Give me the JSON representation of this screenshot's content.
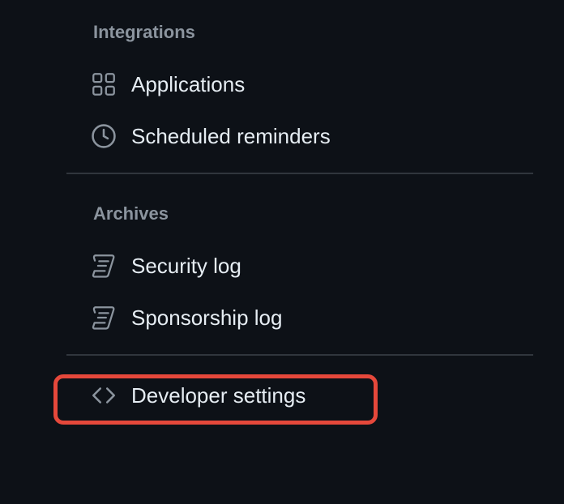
{
  "sections": {
    "integrations": {
      "heading": "Integrations",
      "items": [
        {
          "label": "Applications",
          "icon": "apps-grid-icon"
        },
        {
          "label": "Scheduled reminders",
          "icon": "clock-icon"
        }
      ]
    },
    "archives": {
      "heading": "Archives",
      "items": [
        {
          "label": "Security log",
          "icon": "log-scroll-icon"
        },
        {
          "label": "Sponsorship log",
          "icon": "log-scroll-icon"
        }
      ]
    },
    "developer": {
      "items": [
        {
          "label": "Developer settings",
          "icon": "code-brackets-icon"
        }
      ]
    }
  },
  "colors": {
    "background": "#0d1117",
    "text": "#e6edf3",
    "heading": "#8b949e",
    "divider": "#30363d",
    "highlight": "#e5483b"
  }
}
